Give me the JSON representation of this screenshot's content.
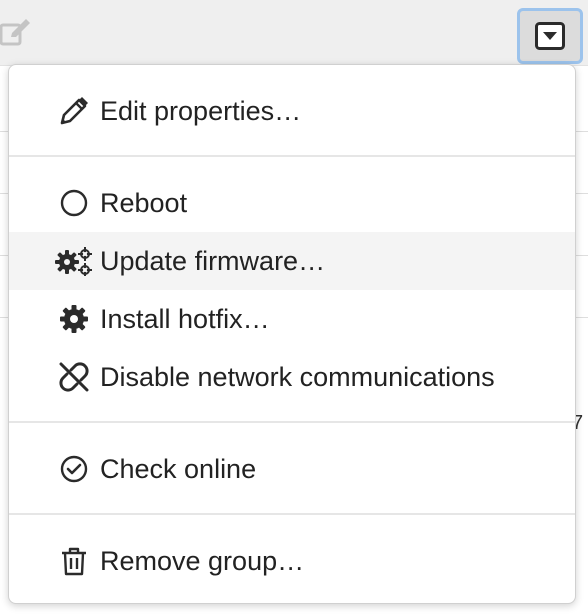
{
  "menu": {
    "items": [
      {
        "id": "edit",
        "label": "Edit properties…",
        "icon": "pencil-icon"
      },
      {
        "id": "reboot",
        "label": "Reboot",
        "icon": "circle-icon"
      },
      {
        "id": "update",
        "label": "Update firmware…",
        "icon": "gears-icon",
        "hovered": true
      },
      {
        "id": "hotfix",
        "label": "Install hotfix…",
        "icon": "gear-icon"
      },
      {
        "id": "disable",
        "label": "Disable network communications",
        "icon": "broken-link-icon"
      },
      {
        "id": "check",
        "label": "Check online",
        "icon": "check-circle-icon"
      },
      {
        "id": "remove",
        "label": "Remove group…",
        "icon": "trash-icon"
      }
    ]
  },
  "background": {
    "glyph": "7"
  },
  "colors": {
    "accent_focus": "#9cc3ec",
    "text": "#222222"
  }
}
